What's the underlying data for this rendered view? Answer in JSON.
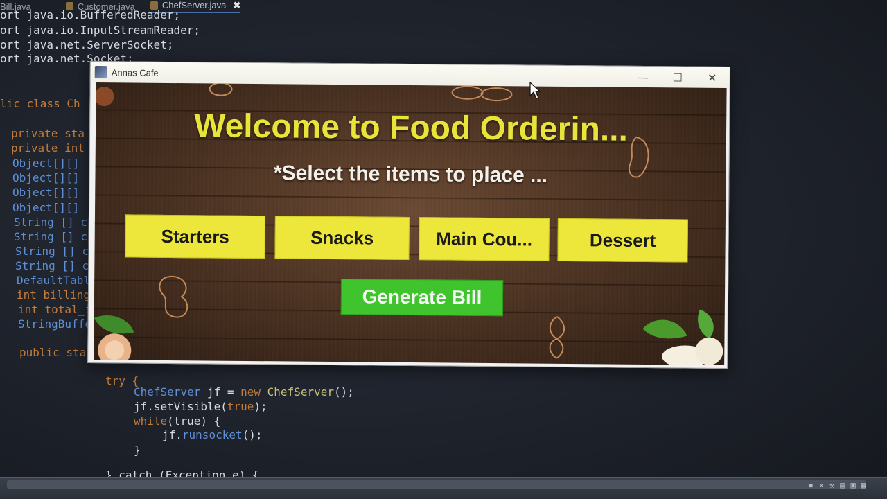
{
  "ide": {
    "tabs": [
      {
        "label": "Bill.java"
      },
      {
        "label": "Customer.java"
      },
      {
        "label": "ChefServer.java",
        "close_glyph": "✖"
      }
    ],
    "code_top": [
      "ort java.io.BufferedReader;",
      "ort java.io.InputStreamReader;",
      "ort java.net.ServerSocket;",
      "ort java.net.Socket;"
    ],
    "code_left": [
      "lic class Ch",
      "private sta",
      "private int",
      "Object[][]",
      "Object[][]",
      "Object[][]",
      "Object[][]",
      "String [] c",
      "String [] c",
      "String [] c",
      "String [] c",
      "DefaultTabl",
      "int billing",
      "int total_i",
      "StringBuffe",
      "public stat"
    ],
    "code_bottom": {
      "try": "try {",
      "line1_type": "ChefServer",
      "line1_var": " jf = ",
      "line1_new": "new",
      "line1_ctor": " ChefServer",
      "line1_end": "();",
      "line2": "jf.setVisible(",
      "line2_arg": "true",
      "line2_end": ");",
      "line3_kw": "while",
      "line3_arg": "(true) {",
      "line4": "jf.",
      "line4_fn": "runsocket",
      "line4_end": "();",
      "line5": "}",
      "line6": "} catch (Exception e) {"
    }
  },
  "window": {
    "title": "Annas Cafe",
    "controls": {
      "minimize": "—",
      "maximize": "☐",
      "close": "✕"
    }
  },
  "main": {
    "welcome": "Welcome to Food Orderin...",
    "subtitle": "*Select the items to place ...",
    "categories": [
      "Starters",
      "Snacks",
      "Main Cou...",
      "Dessert"
    ],
    "generate_bill": "Generate Bill"
  },
  "colors": {
    "welcome_text": "#e9e43a",
    "category_button": "#ece73a",
    "bill_button": "#3fc42d",
    "wood_background": "#4e3423"
  }
}
